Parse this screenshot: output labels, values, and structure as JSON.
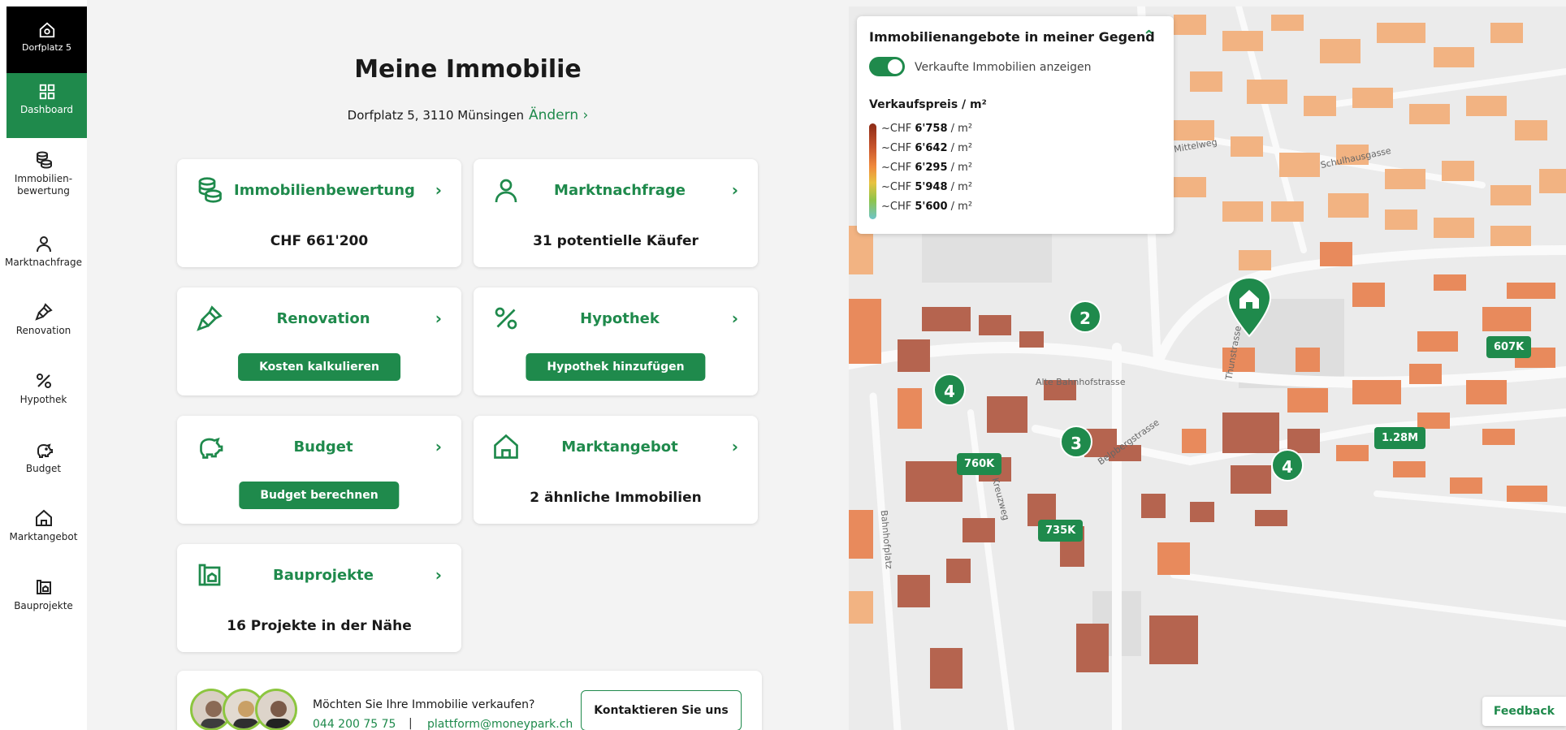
{
  "sidebar": {
    "top": {
      "label": "Dorfplatz 5",
      "icon": "house-gear-icon"
    },
    "items": [
      {
        "label": "Dashboard",
        "icon": "grid-icon",
        "active": true
      },
      {
        "label": "Immobilien-\nbewertung",
        "icon": "coins-icon"
      },
      {
        "label": "Marktnachfrage",
        "icon": "person-icon"
      },
      {
        "label": "Renovation",
        "icon": "brush-icon"
      },
      {
        "label": "Hypothek",
        "icon": "percent-icon"
      },
      {
        "label": "Budget",
        "icon": "piggy-bank-icon"
      },
      {
        "label": "Marktangebot",
        "icon": "house-icon"
      },
      {
        "label": "Bauprojekte",
        "icon": "blueprint-icon"
      }
    ]
  },
  "main": {
    "title": "Meine Immobilie",
    "address": "Dorfplatz 5, 3110 Münsingen",
    "change_label": "Ändern ›",
    "cards": [
      {
        "title": "Immobilienbewertung",
        "value": "CHF 661'200",
        "icon": "coins-icon",
        "arrow": "›"
      },
      {
        "title": "Marktnachfrage",
        "value": "31 potentielle Käufer",
        "icon": "person-icon",
        "arrow": "›"
      },
      {
        "title": "Renovation",
        "button": "Kosten kalkulieren",
        "icon": "brush-icon",
        "arrow": "›"
      },
      {
        "title": "Hypothek",
        "button": "Hypothek hinzufügen",
        "icon": "percent-icon",
        "arrow": "›"
      },
      {
        "title": "Budget",
        "button": "Budget berechnen",
        "icon": "piggy-bank-icon",
        "arrow": "›"
      },
      {
        "title": "Marktangebot",
        "value": "2 ähnliche Immobilien",
        "icon": "house-icon",
        "arrow": "›"
      },
      {
        "title": "Bauprojekte",
        "value": "16 Projekte in der Nähe",
        "icon": "blueprint-icon",
        "arrow": "›"
      }
    ],
    "contact": {
      "question": "Möchten Sie Ihre Immobilie verkaufen?",
      "phone": "044 200 75 75",
      "separator": "|",
      "email": "plattform@moneypark.ch",
      "button": "Kontaktieren Sie uns"
    }
  },
  "map": {
    "legend": {
      "title": "Immobilienangebote in meiner Gegend",
      "chevron": "⌃",
      "toggle_label": "Verkaufte Immobilien anzeigen",
      "toggle_on": true,
      "price_title": "Verkaufspreis / m²",
      "rows": [
        {
          "prefix": "~CHF ",
          "value": "6'758",
          "unit": " / m²"
        },
        {
          "prefix": "~CHF ",
          "value": "6'642",
          "unit": " / m²"
        },
        {
          "prefix": "~CHF ",
          "value": "6'295",
          "unit": " / m²"
        },
        {
          "prefix": "~CHF ",
          "value": "5'948",
          "unit": " / m²"
        },
        {
          "prefix": "~CHF ",
          "value": "5'600",
          "unit": " / m²"
        }
      ]
    },
    "price_labels": [
      "607K",
      "1.28M",
      "760K",
      "735K"
    ],
    "clusters": [
      "2",
      "4",
      "3",
      "4"
    ],
    "streets": [
      "Alte Bahnhofstrasse",
      "Thunstrasse",
      "Belpbergstrasse",
      "Kreuzweg",
      "Bahnhofplatz",
      "Mittelweg",
      "Schulhausgasse"
    ],
    "feedback": "Feedback",
    "colors": {
      "accent": "#1f8a4c",
      "building_dark": "#b5644f",
      "building_orange": "#e88a5c",
      "building_light": "#f2b382"
    }
  }
}
